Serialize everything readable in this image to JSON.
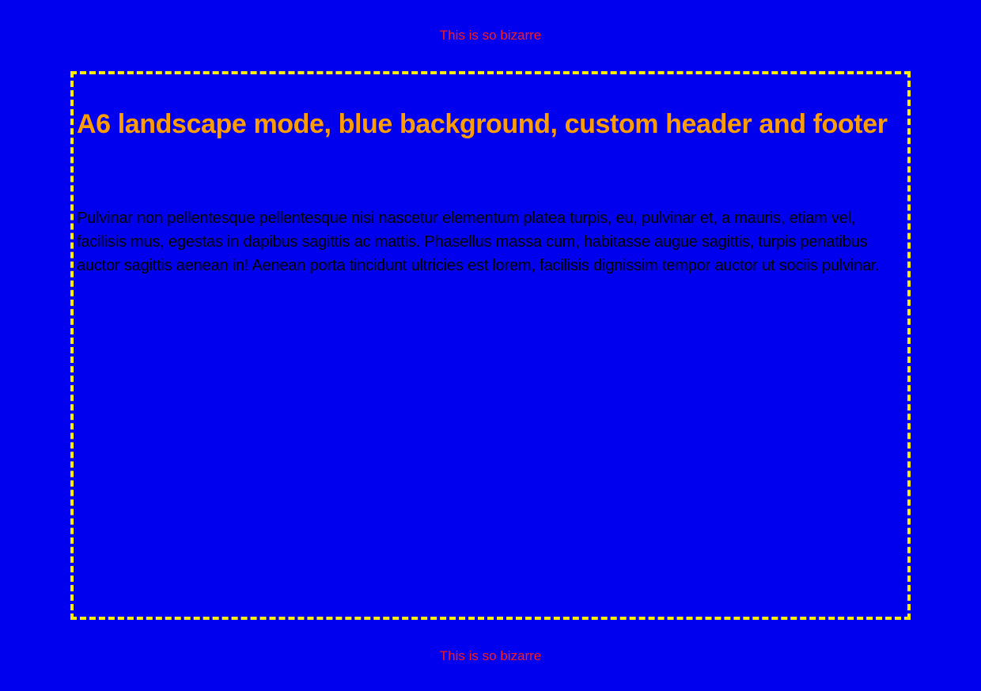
{
  "page": {
    "background_color": "#0000ee",
    "header_text": "This is so bizarre",
    "footer_text": "This is so bizarre",
    "header_color": "#ff1a1a",
    "frame_border_color": "#ffee00"
  },
  "content": {
    "title": "A6 landscape mode, blue background, custom header and footer",
    "title_color": "#ff9d00",
    "body": "Pulvinar non pellentesque pellentesque nisi nascetur elementum platea turpis, eu, pulvinar et, a mauris, etiam vel, facilisis mus, egestas in dapibus sagittis ac mattis. Phasellus massa cum, habitasse augue sagittis, turpis penatibus auctor sagittis aenean in! Aenean porta tincidunt ultricies est lorem, facilisis dignissim tempor auctor ut sociis pulvinar.",
    "body_color": "#000000"
  }
}
